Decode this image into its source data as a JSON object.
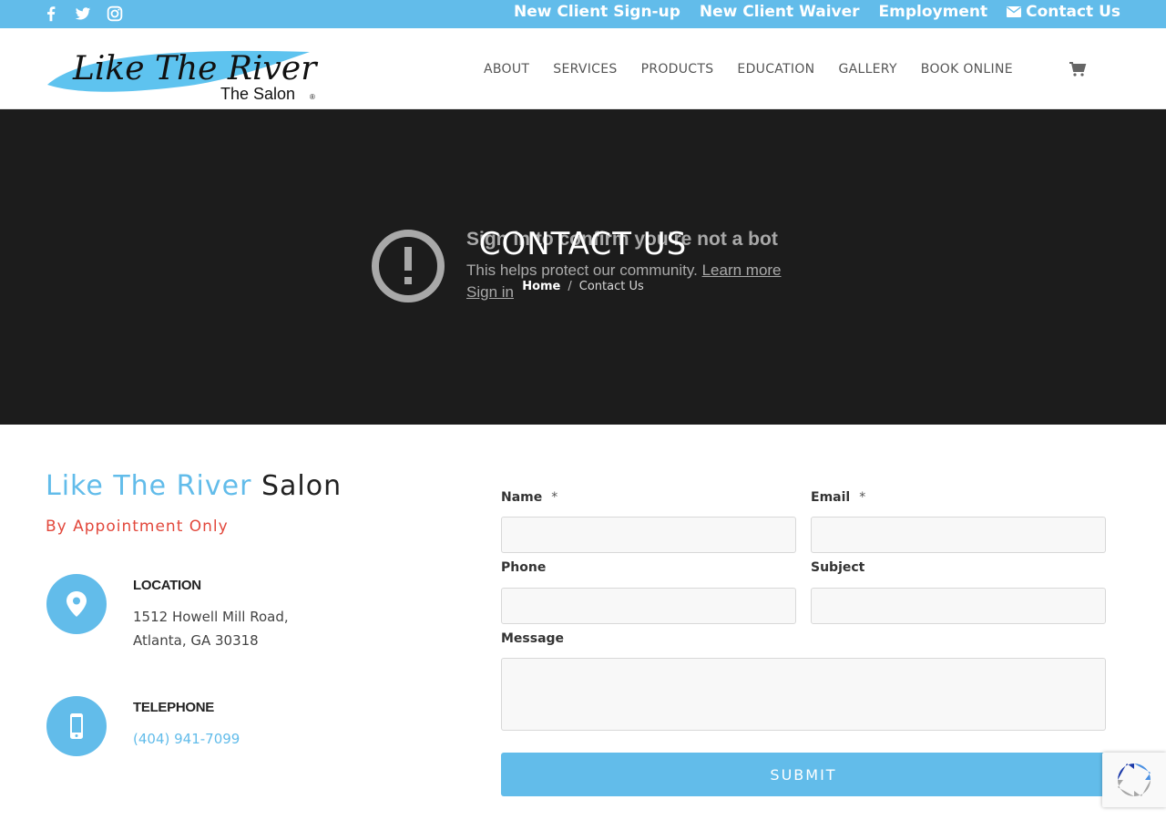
{
  "topbar": {
    "social": [
      {
        "icon": "facebook-icon"
      },
      {
        "icon": "twitter-icon"
      },
      {
        "icon": "instagram-icon"
      }
    ],
    "links": [
      {
        "label": "New Client Sign-up"
      },
      {
        "label": "New Client Waiver"
      },
      {
        "label": "Employment"
      },
      {
        "label": "Contact Us",
        "icon": "envelope-icon"
      }
    ]
  },
  "header": {
    "logo": {
      "line1": "Like The River",
      "line2": "The Salon",
      "mark": "®"
    },
    "nav": [
      "ABOUT",
      "SERVICES",
      "PRODUCTS",
      "EDUCATION",
      "GALLERY",
      "BOOK ONLINE"
    ],
    "cart_icon": "cart-icon"
  },
  "hero": {
    "title": "CONTACT US",
    "breadcrumb": {
      "home": "Home",
      "separator": "/",
      "current": "Contact Us"
    },
    "bot_overlay": {
      "title": "Sign in to confirm you’re not a bot",
      "description": "This helps protect our community.",
      "learn_more": "Learn more",
      "sign_in": "Sign in"
    }
  },
  "info": {
    "title_blue": "Like The River",
    "title_dark": "Salon",
    "subtitle": "By Appointment Only",
    "location": {
      "heading": "LOCATION",
      "line1": "1512 Howell Mill Road,",
      "line2": "Atlanta, GA 30318"
    },
    "telephone": {
      "heading": "TELEPHONE",
      "number": "(404) 941-7099"
    }
  },
  "form": {
    "name_label": "Name",
    "email_label": "Email",
    "required_mark": "*",
    "phone_label": "Phone",
    "subject_label": "Subject",
    "message_label": "Message",
    "submit_label": "SUBMIT"
  },
  "colors": {
    "accent": "#62bcea",
    "hero_bg": "#1c1c1c",
    "subtitle_red": "#e2483c"
  }
}
